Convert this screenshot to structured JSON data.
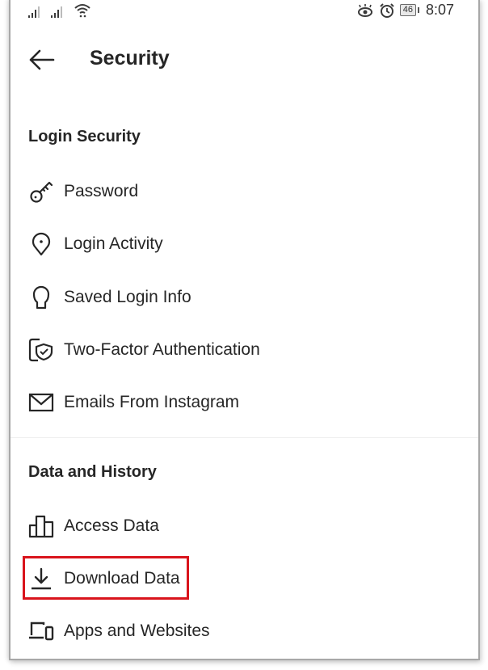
{
  "status_bar": {
    "time": "8:07",
    "battery": "46",
    "icons": [
      "signal-icon",
      "signal-icon",
      "wifi-icon",
      "eye-comfort-icon",
      "alarm-icon",
      "battery-icon"
    ]
  },
  "header": {
    "back_icon": "arrow-left-icon",
    "title": "Security"
  },
  "sections": [
    {
      "title": "Login Security",
      "items": [
        {
          "label": "Password",
          "icon": "key-icon"
        },
        {
          "label": "Login Activity",
          "icon": "location-pin-icon"
        },
        {
          "label": "Saved Login Info",
          "icon": "keyhole-icon"
        },
        {
          "label": "Two-Factor Authentication",
          "icon": "phone-shield-icon"
        },
        {
          "label": "Emails From Instagram",
          "icon": "envelope-icon"
        }
      ]
    },
    {
      "title": "Data and History",
      "items": [
        {
          "label": "Access Data",
          "icon": "bar-chart-icon"
        },
        {
          "label": "Download Data",
          "icon": "download-icon",
          "highlighted": true
        },
        {
          "label": "Apps and Websites",
          "icon": "devices-icon"
        }
      ]
    }
  ],
  "highlight_color": "#d9141c"
}
